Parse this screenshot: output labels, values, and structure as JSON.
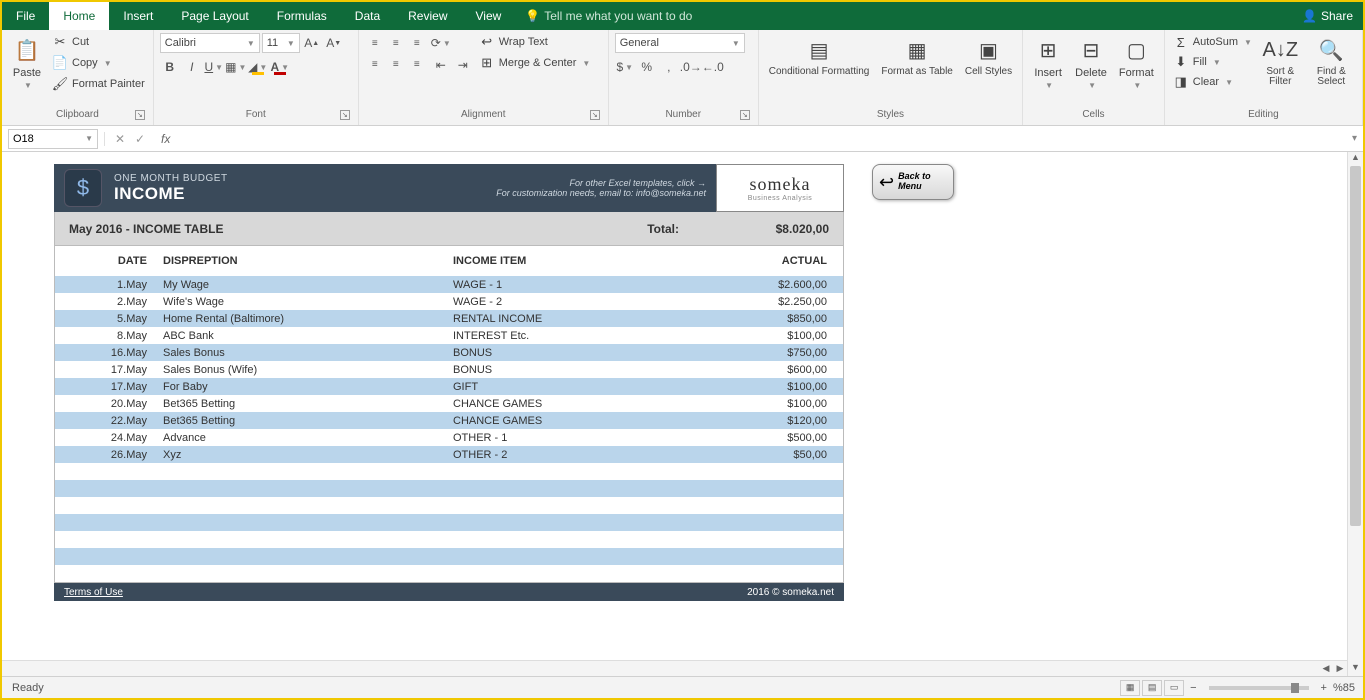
{
  "tabs": {
    "file": "File",
    "home": "Home",
    "insert": "Insert",
    "pageLayout": "Page Layout",
    "formulas": "Formulas",
    "data": "Data",
    "review": "Review",
    "view": "View"
  },
  "tellMe": "Tell me what you want to do",
  "share": "Share",
  "ribbon": {
    "clipboard": {
      "label": "Clipboard",
      "paste": "Paste",
      "cut": "Cut",
      "copy": "Copy",
      "formatPainter": "Format Painter"
    },
    "font": {
      "label": "Font",
      "name": "Calibri",
      "size": "11"
    },
    "alignment": {
      "label": "Alignment",
      "wrap": "Wrap Text",
      "merge": "Merge & Center"
    },
    "number": {
      "label": "Number",
      "format": "General"
    },
    "styles": {
      "label": "Styles",
      "cond": "Conditional Formatting",
      "fat": "Format as Table",
      "cell": "Cell Styles"
    },
    "cells": {
      "label": "Cells",
      "insert": "Insert",
      "delete": "Delete",
      "format": "Format"
    },
    "editing": {
      "label": "Editing",
      "autosum": "AutoSum",
      "fill": "Fill",
      "clear": "Clear",
      "sort": "Sort & Filter",
      "find": "Find & Select"
    }
  },
  "namebox": "O18",
  "template": {
    "title1": "ONE MONTH BUDGET",
    "title2": "INCOME",
    "otherLine": "For other Excel templates, click →",
    "customLine": "For customization needs, email to: info@someka.net",
    "logoBig": "someka",
    "logoSmall": "Business Analysis",
    "tableTitle": "May 2016 - INCOME TABLE",
    "totalLabel": "Total:",
    "totalValue": "$8.020,00",
    "cols": {
      "date": "DATE",
      "desc": "DISPREPTION",
      "item": "INCOME ITEM",
      "actual": "ACTUAL"
    },
    "rows": [
      {
        "date": "1.May",
        "desc": "My Wage",
        "item": "WAGE - 1",
        "actual": "$2.600,00"
      },
      {
        "date": "2.May",
        "desc": "Wife's Wage",
        "item": "WAGE - 2",
        "actual": "$2.250,00"
      },
      {
        "date": "5.May",
        "desc": "Home Rental (Baltimore)",
        "item": "RENTAL INCOME",
        "actual": "$850,00"
      },
      {
        "date": "8.May",
        "desc": "ABC Bank",
        "item": "INTEREST Etc.",
        "actual": "$100,00"
      },
      {
        "date": "16.May",
        "desc": "Sales Bonus",
        "item": "BONUS",
        "actual": "$750,00"
      },
      {
        "date": "17.May",
        "desc": "Sales Bonus (Wife)",
        "item": "BONUS",
        "actual": "$600,00"
      },
      {
        "date": "17.May",
        "desc": "For Baby",
        "item": "GIFT",
        "actual": "$100,00"
      },
      {
        "date": "20.May",
        "desc": "Bet365 Betting",
        "item": "CHANCE GAMES",
        "actual": "$100,00"
      },
      {
        "date": "22.May",
        "desc": "Bet365 Betting",
        "item": "CHANCE GAMES",
        "actual": "$120,00"
      },
      {
        "date": "24.May",
        "desc": "Advance",
        "item": "OTHER - 1",
        "actual": "$500,00"
      },
      {
        "date": "26.May",
        "desc": "Xyz",
        "item": "OTHER - 2",
        "actual": "$50,00"
      }
    ],
    "emptyRows": 7,
    "terms": "Terms of Use",
    "copyright": "2016 © someka.net"
  },
  "backBtn": "Back to Menu",
  "status": {
    "ready": "Ready",
    "zoom": "%85"
  }
}
